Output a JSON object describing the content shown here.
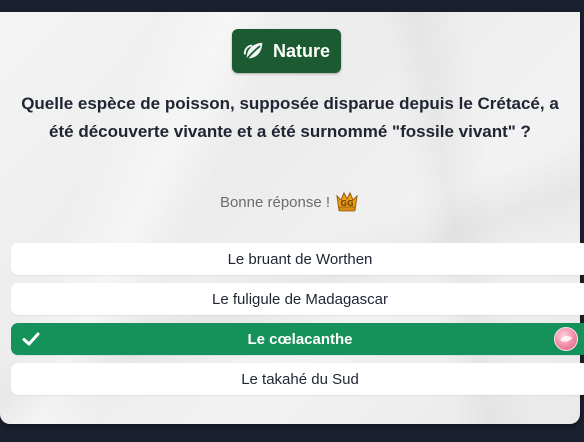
{
  "category": {
    "label": "Nature",
    "icon": "leaf-icon",
    "color": "#1c5b32"
  },
  "question": {
    "text": "Quelle espèce de poisson, supposée disparue depuis le Crétacé, a été découverte vivante et a été surnommé \"fossile vivant\" ?"
  },
  "feedback": {
    "text": "Bonne réponse !",
    "icon": "gg-emote-icon"
  },
  "answers": [
    {
      "label": "Le bruant de Worthen",
      "state": "neutral"
    },
    {
      "label": "Le fuligule de Madagascar",
      "state": "neutral"
    },
    {
      "label": "Le cœlacanthe",
      "state": "correct",
      "icon": "check-icon",
      "avatar": "player-avatar"
    },
    {
      "label": "Le takahé du Sud",
      "state": "neutral"
    }
  ],
  "colors": {
    "correct": "#15915a",
    "background": "#1b2030",
    "card": "#f2f2f2",
    "text": "#1f2533"
  }
}
